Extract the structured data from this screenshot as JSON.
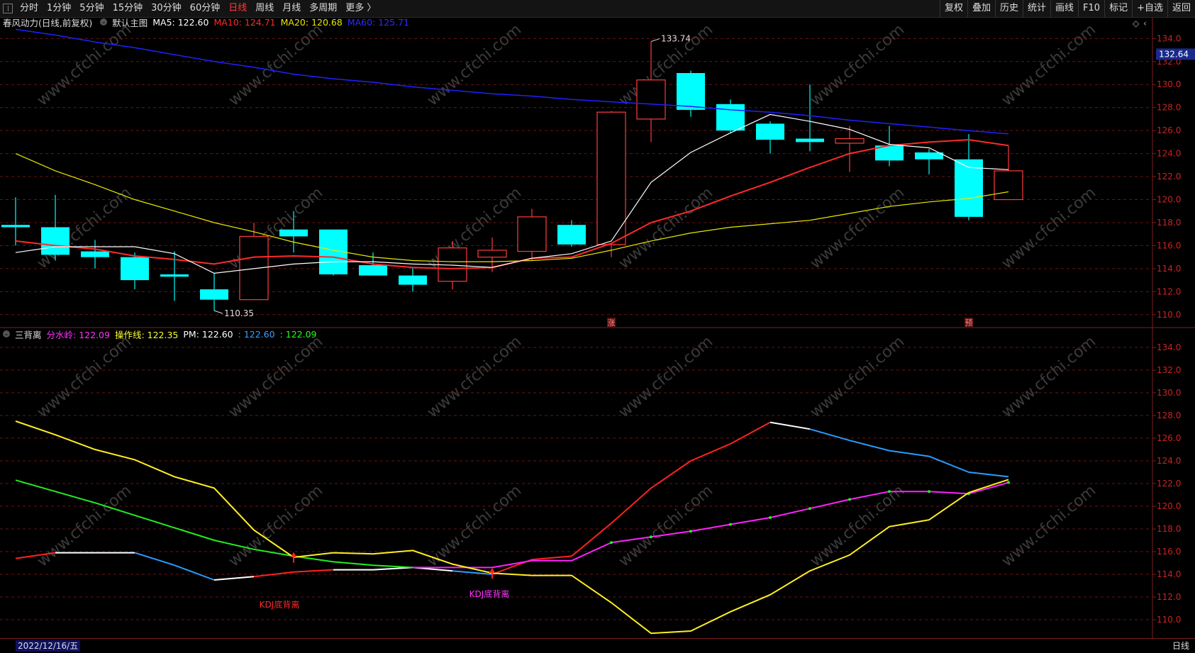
{
  "toolbar": {
    "periods": [
      "分时",
      "1分钟",
      "5分钟",
      "15分钟",
      "30分钟",
      "60分钟",
      "日线",
      "周线",
      "月线",
      "多周期",
      "更多 〉"
    ],
    "active_period": "日线",
    "tools": [
      "复权",
      "叠加",
      "历史",
      "统计",
      "画线",
      "F10",
      "标记",
      "+自选",
      "返回"
    ]
  },
  "main_legend": {
    "stock": "春风动力(日线,前复权)",
    "template": "默认主图",
    "ma5": "MA5: 122.60",
    "ma10": "MA10: 124.71",
    "ma20": "MA20: 120.68",
    "ma60": "MA60: 125.71"
  },
  "sub_legend": {
    "name": "三背离",
    "fsl": "分水岭: 122.09",
    "czx": "操作线: 122.35",
    "pm": "PM: 122.60",
    "v1": ": 122.60",
    "v2": ": 122.09"
  },
  "price_tag": "132.64",
  "watermark": "www.cfchi.com",
  "bottom": {
    "date": "2022/12/16/五",
    "period": "日线"
  },
  "colors": {
    "up": "#ff3b3b",
    "down": "#00ffff",
    "ma5": "#ffffff",
    "ma10": "#ff2a2a",
    "ma20": "#e8e800",
    "ma60": "#2020ff"
  },
  "chart_data": [
    {
      "type": "candlestick",
      "title": "春风动力(日线,前复权)",
      "ylim": [
        109,
        135.5
      ],
      "yticks": [
        110,
        112,
        114,
        116,
        118,
        120,
        122,
        124,
        126,
        128,
        130,
        132,
        134
      ],
      "ohlc": [
        [
          117.8,
          120.2,
          116.0,
          117.6
        ],
        [
          117.6,
          120.4,
          114.7,
          115.2
        ],
        [
          115.5,
          116.5,
          114.0,
          115.0
        ],
        [
          115.0,
          115.4,
          112.2,
          113.0
        ],
        [
          113.5,
          115.5,
          111.2,
          113.3
        ],
        [
          112.2,
          113.6,
          110.35,
          111.3
        ],
        [
          111.3,
          118.0,
          111.3,
          116.8
        ],
        [
          117.4,
          119.0,
          115.4,
          116.8
        ],
        [
          117.4,
          117.4,
          113.4,
          113.5
        ],
        [
          114.3,
          115.4,
          113.4,
          113.4
        ],
        [
          113.4,
          114.1,
          112.0,
          112.6
        ],
        [
          112.9,
          116.4,
          112.2,
          115.8
        ],
        [
          115.0,
          116.7,
          113.7,
          115.6
        ],
        [
          115.5,
          119.2,
          114.7,
          118.5
        ],
        [
          117.8,
          118.2,
          115.9,
          116.1
        ],
        [
          116.1,
          127.7,
          115.0,
          127.6
        ],
        [
          127.0,
          133.74,
          125.0,
          130.4
        ],
        [
          131.0,
          131.2,
          127.2,
          127.8
        ],
        [
          128.3,
          128.7,
          125.8,
          126.0
        ],
        [
          126.6,
          126.8,
          124.0,
          125.2
        ],
        [
          125.3,
          130.0,
          124.2,
          125.0
        ],
        [
          124.9,
          126.4,
          122.4,
          125.3
        ],
        [
          124.7,
          126.4,
          122.9,
          123.4
        ],
        [
          124.1,
          124.4,
          122.2,
          123.5
        ],
        [
          123.5,
          125.7,
          118.2,
          118.5
        ],
        [
          120.0,
          124.7,
          120.0,
          122.5
        ]
      ],
      "ma5": [
        115.4,
        115.9,
        115.9,
        115.9,
        115.3,
        113.6,
        114.0,
        114.4,
        114.6,
        114.6,
        114.4,
        114.3,
        114.1,
        114.9,
        115.3,
        116.4,
        121.5,
        124.1,
        125.8,
        127.4,
        126.8,
        126.1,
        124.8,
        124.5,
        122.8,
        122.6
      ],
      "ma10": [
        116.4,
        116.0,
        115.7,
        115.1,
        114.8,
        114.4,
        115.0,
        115.1,
        115.0,
        114.4,
        114.1,
        114.0,
        114.1,
        114.9,
        115.0,
        116.2,
        118.0,
        119.0,
        120.3,
        121.5,
        122.8,
        124.0,
        124.7,
        125.0,
        125.2,
        124.7
      ],
      "ma20": [
        124.0,
        122.5,
        121.3,
        120.0,
        119.0,
        118.0,
        117.2,
        116.3,
        115.6,
        115.0,
        114.7,
        114.6,
        114.6,
        114.7,
        114.9,
        115.6,
        116.4,
        117.1,
        117.6,
        117.9,
        118.2,
        118.8,
        119.4,
        119.8,
        120.1,
        120.68
      ],
      "ma60": [
        134.8,
        134.3,
        133.7,
        133.2,
        132.6,
        132.0,
        131.5,
        130.9,
        130.5,
        130.2,
        129.8,
        129.5,
        129.2,
        129.0,
        128.7,
        128.5,
        128.3,
        128.1,
        127.8,
        127.6,
        127.3,
        126.9,
        126.6,
        126.3,
        126.0,
        125.71
      ],
      "annotations": [
        {
          "text": "133.74",
          "bar": 16,
          "value": 133.74
        },
        {
          "text": "110.35",
          "bar": 5,
          "value": 110.35
        },
        {
          "text": "涨",
          "bar": 15
        },
        {
          "text": "预",
          "bar": 24
        }
      ]
    },
    {
      "type": "line",
      "title": "三背离",
      "ylim": [
        108.5,
        135.5
      ],
      "yticks": [
        110,
        112,
        114,
        116,
        118,
        120,
        122,
        124,
        126,
        128,
        130,
        132,
        134
      ],
      "series": [
        {
          "name": "PM",
          "values": [
            115.4,
            115.9,
            115.9,
            115.9,
            114.8,
            113.5,
            113.8,
            114.2,
            114.4,
            114.4,
            114.6,
            114.3,
            114.0,
            115.3,
            115.6,
            118.5,
            121.6,
            124.0,
            125.5,
            127.4,
            126.8,
            125.8,
            124.9,
            124.4,
            123.0,
            122.6
          ]
        },
        {
          "name": "操作线",
          "values": [
            127.5,
            126.3,
            125.0,
            124.1,
            122.6,
            121.6,
            117.9,
            115.5,
            115.9,
            115.8,
            116.1,
            114.9,
            114.1,
            113.9,
            113.9,
            111.5,
            108.8,
            109.0,
            110.7,
            112.2,
            114.3,
            115.7,
            118.2,
            118.8,
            121.2,
            122.35
          ]
        },
        {
          "name": "分水岭",
          "values": [
            122.3,
            null,
            null,
            null,
            null,
            null,
            null,
            null,
            null,
            null,
            114.6,
            114.6,
            114.6,
            115.2,
            115.2,
            116.8,
            117.3,
            117.8,
            118.4,
            119.0,
            119.8,
            120.6,
            121.3,
            121.3,
            121.1,
            122.09
          ]
        },
        {
          "name": "",
          "values": [
            122.3,
            121.3,
            120.3,
            119.2,
            118.1,
            117.0,
            116.2,
            115.6,
            115.1,
            114.8,
            114.6,
            null,
            null,
            null,
            null,
            null,
            null,
            null,
            null,
            null,
            null,
            null,
            null,
            null,
            null,
            null
          ]
        }
      ],
      "annotations": [
        {
          "text": "KDJ底背离",
          "bar": 7
        },
        {
          "text": "KDJ底背离",
          "bar": 12
        }
      ]
    }
  ]
}
